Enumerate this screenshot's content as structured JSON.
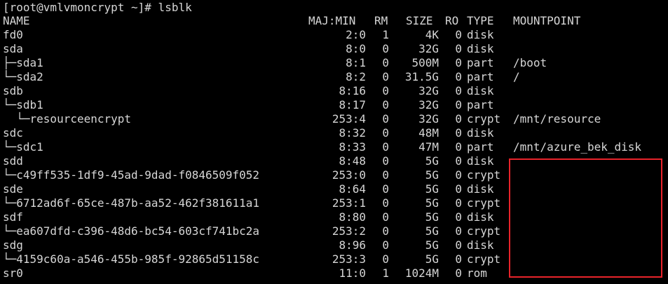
{
  "terminal": {
    "prompt": "[root@vmlvmoncrypt ~]# lsblk",
    "headers": {
      "name": "NAME",
      "majmin": "MAJ:MIN",
      "rm": "RM",
      "size": "SIZE",
      "ro": "RO",
      "type": "TYPE",
      "mountpoint": "MOUNTPOINT"
    },
    "rows": [
      {
        "name": "fd0",
        "majmin": "2:0",
        "rm": "1",
        "size": "4K",
        "ro": "0",
        "type": "disk",
        "mountpoint": ""
      },
      {
        "name": "sda",
        "majmin": "8:0",
        "rm": "0",
        "size": "32G",
        "ro": "0",
        "type": "disk",
        "mountpoint": ""
      },
      {
        "name": "├─sda1",
        "majmin": "8:1",
        "rm": "0",
        "size": "500M",
        "ro": "0",
        "type": "part",
        "mountpoint": "/boot"
      },
      {
        "name": "└─sda2",
        "majmin": "8:2",
        "rm": "0",
        "size": "31.5G",
        "ro": "0",
        "type": "part",
        "mountpoint": "/"
      },
      {
        "name": "sdb",
        "majmin": "8:16",
        "rm": "0",
        "size": "32G",
        "ro": "0",
        "type": "disk",
        "mountpoint": ""
      },
      {
        "name": "└─sdb1",
        "majmin": "8:17",
        "rm": "0",
        "size": "32G",
        "ro": "0",
        "type": "part",
        "mountpoint": ""
      },
      {
        "name": "  └─resourceencrypt",
        "majmin": "253:4",
        "rm": "0",
        "size": "32G",
        "ro": "0",
        "type": "crypt",
        "mountpoint": "/mnt/resource"
      },
      {
        "name": "sdc",
        "majmin": "8:32",
        "rm": "0",
        "size": "48M",
        "ro": "0",
        "type": "disk",
        "mountpoint": ""
      },
      {
        "name": "└─sdc1",
        "majmin": "8:33",
        "rm": "0",
        "size": "47M",
        "ro": "0",
        "type": "part",
        "mountpoint": "/mnt/azure_bek_disk"
      },
      {
        "name": "sdd",
        "majmin": "8:48",
        "rm": "0",
        "size": "5G",
        "ro": "0",
        "type": "disk",
        "mountpoint": ""
      },
      {
        "name": "└─c49ff535-1df9-45ad-9dad-f0846509f052",
        "majmin": "253:0",
        "rm": "0",
        "size": "5G",
        "ro": "0",
        "type": "crypt",
        "mountpoint": ""
      },
      {
        "name": "sde",
        "majmin": "8:64",
        "rm": "0",
        "size": "5G",
        "ro": "0",
        "type": "disk",
        "mountpoint": ""
      },
      {
        "name": "└─6712ad6f-65ce-487b-aa52-462f381611a1",
        "majmin": "253:1",
        "rm": "0",
        "size": "5G",
        "ro": "0",
        "type": "crypt",
        "mountpoint": ""
      },
      {
        "name": "sdf",
        "majmin": "8:80",
        "rm": "0",
        "size": "5G",
        "ro": "0",
        "type": "disk",
        "mountpoint": ""
      },
      {
        "name": "└─ea607dfd-c396-48d6-bc54-603cf741bc2a",
        "majmin": "253:2",
        "rm": "0",
        "size": "5G",
        "ro": "0",
        "type": "crypt",
        "mountpoint": ""
      },
      {
        "name": "sdg",
        "majmin": "8:96",
        "rm": "0",
        "size": "5G",
        "ro": "0",
        "type": "disk",
        "mountpoint": ""
      },
      {
        "name": "└─4159c60a-a546-455b-985f-92865d51158c",
        "majmin": "253:3",
        "rm": "0",
        "size": "5G",
        "ro": "0",
        "type": "crypt",
        "mountpoint": ""
      },
      {
        "name": "sr0",
        "majmin": "11:0",
        "rm": "1",
        "size": "1024M",
        "ro": "0",
        "type": "rom",
        "mountpoint": ""
      }
    ]
  },
  "colors": {
    "background": "#000000",
    "text": "#d6d6d6",
    "highlight_border": "#e8232a"
  }
}
